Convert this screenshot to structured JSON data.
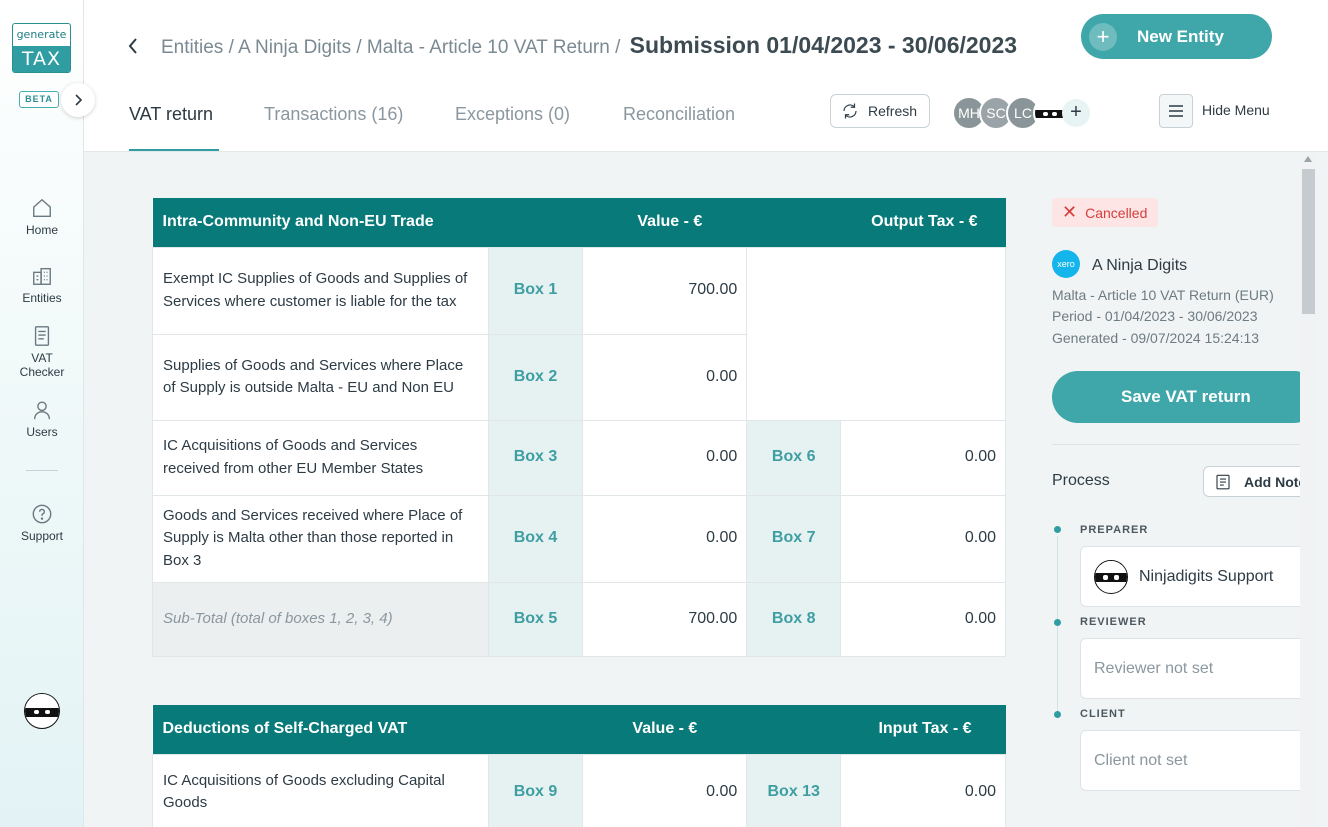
{
  "sidebar": {
    "logo_top": "generate",
    "logo_bottom": "TAX",
    "badge": "BETA",
    "items": [
      {
        "label": "Home",
        "icon": "home-icon"
      },
      {
        "label": "Entities",
        "icon": "buildings-icon"
      },
      {
        "label_line1": "VAT",
        "label_line2": "Checker",
        "icon": "document-icon"
      },
      {
        "label": "Users",
        "icon": "user-icon"
      },
      {
        "label": "Support",
        "icon": "help-icon"
      }
    ]
  },
  "header": {
    "breadcrumb": "Entities / A Ninja Digits / Malta - Article 10 VAT Return /",
    "current": "Submission 01/04/2023 - 30/06/2023",
    "new_entity_label": "New Entity",
    "tabs": [
      "VAT return",
      "Transactions (16)",
      "Exceptions (0)",
      "Reconciliation"
    ],
    "refresh_label": "Refresh",
    "users": [
      {
        "initials": "MH",
        "color": "#8a9599"
      },
      {
        "initials": "SC",
        "color": "#9aa3a7"
      },
      {
        "initials": "LC",
        "color": "#8a9599"
      }
    ],
    "add_user": "+",
    "hide_menu_label": "Hide Menu"
  },
  "table1": {
    "headers": [
      "Intra-Community and Non-EU Trade",
      "Value - €",
      "Output Tax - €"
    ],
    "rows": [
      {
        "desc": "Exempt IC Supplies of Goods and Supplies of Services where customer is liable for the tax",
        "box": "Box 1",
        "value": "700.00"
      },
      {
        "desc": "Supplies of Goods and Services where Place of Supply is outside Malta - EU and Non EU",
        "box": "Box 2",
        "value": "0.00"
      },
      {
        "desc": "IC Acquisitions of Goods and Services received from other EU Member States",
        "box": "Box 3",
        "value": "0.00",
        "tax_box": "Box 6",
        "tax": "0.00"
      },
      {
        "desc": "Goods and Services received where Place of Supply is Malta other than those reported in Box 3",
        "box": "Box 4",
        "value": "0.00",
        "tax_box": "Box 7",
        "tax": "0.00"
      },
      {
        "desc": "Sub-Total (total of boxes 1, 2, 3, 4)",
        "box": "Box 5",
        "value": "700.00",
        "tax_box": "Box 8",
        "tax": "0.00"
      }
    ]
  },
  "table2": {
    "headers": [
      "Deductions of Self-Charged VAT",
      "Value - €",
      "Input Tax - €"
    ],
    "rows": [
      {
        "desc": "IC Acquisitions of Goods excluding Capital Goods",
        "box": "Box 9",
        "value": "0.00",
        "tax_box": "Box 13",
        "tax": "0.00"
      }
    ]
  },
  "panel": {
    "status": "Cancelled",
    "xero_logo": "xero",
    "entity": "A Ninja Digits",
    "return_type": "Malta - Article 10 VAT Return (EUR)",
    "period": "Period - 01/04/2023 - 30/06/2023",
    "generated": "Generated - 09/07/2024 15:24:13",
    "save_label": "Save VAT return",
    "process_label": "Process",
    "add_note_label": "Add Note",
    "preparer_role": "PREPARER",
    "preparer": "Ninjadigits Support",
    "reviewer_role": "REVIEWER",
    "reviewer": "Reviewer not set",
    "client_role": "CLIENT",
    "client": "Client not set"
  },
  "colors": {
    "accent": "#3fa6a9",
    "table_header": "#077a79",
    "cancelled": "#d63d3d"
  }
}
